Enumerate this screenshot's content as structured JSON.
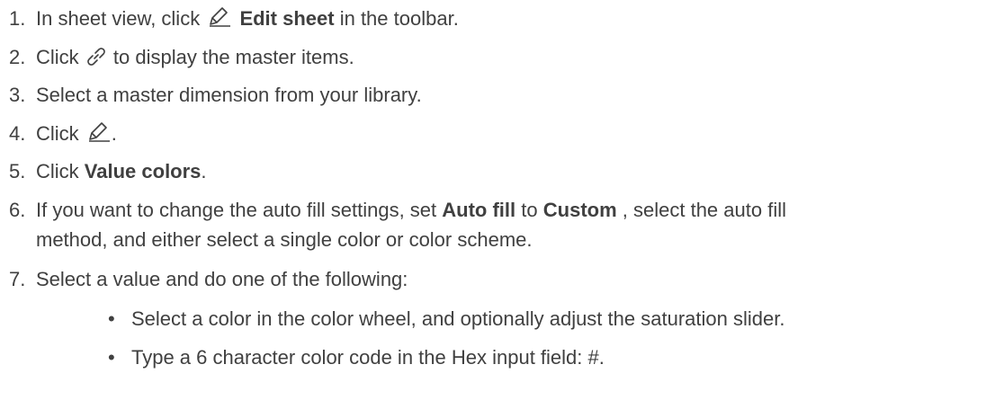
{
  "steps": [
    {
      "num": "1.",
      "pre": "In sheet view, click",
      "bold": "Edit sheet",
      "post": "in the toolbar.",
      "icon": "pencil-icon"
    },
    {
      "num": "2.",
      "pre": "Click",
      "post": "to display the master items.",
      "icon": "link-icon"
    },
    {
      "num": "3.",
      "text": "Select a master dimension from your library."
    },
    {
      "num": "4.",
      "pre": "Click",
      "post": ".",
      "icon": "pencil-icon"
    },
    {
      "num": "5.",
      "pre": "Click",
      "bold": "Value colors",
      "post": "."
    },
    {
      "num": "6.",
      "line1_pre": "If you want to change the auto fill settings, set",
      "bold1": "Auto fill",
      "mid": "to",
      "bold2": "Custom",
      "line1_post": ", select the auto fill",
      "line2": "method, and either select a single color or color scheme."
    },
    {
      "num": "7.",
      "text": "Select a value and do one of the following:"
    }
  ],
  "bullets": [
    {
      "marker": "•",
      "text": "Select a color in the color wheel, and optionally adjust the saturation slider."
    },
    {
      "marker": "•",
      "text": "Type a 6 character color code in the Hex input field: #."
    }
  ]
}
